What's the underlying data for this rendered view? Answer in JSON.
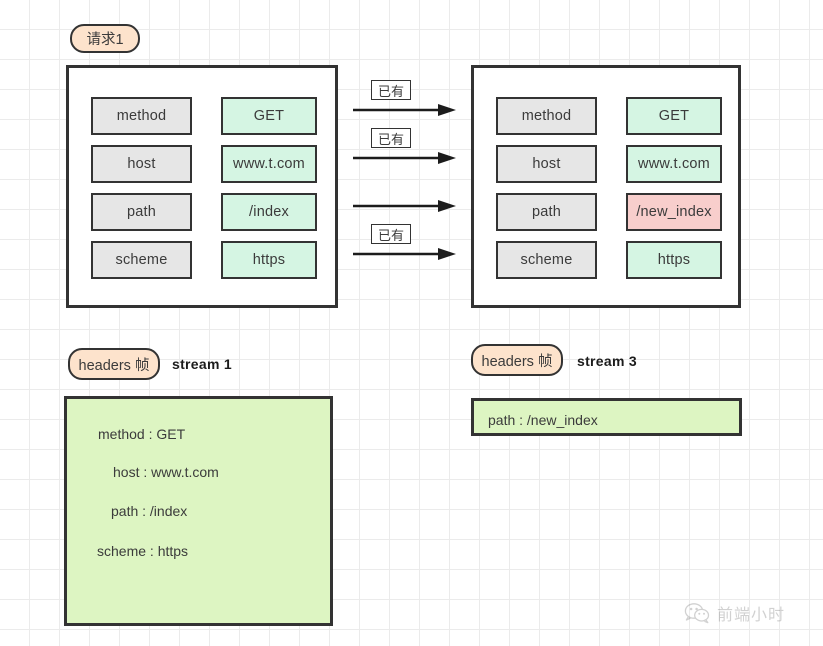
{
  "diagram": {
    "title_badge": "请求1",
    "request_panel_left": {
      "rows": [
        {
          "key": "method",
          "value": "GET"
        },
        {
          "key": "host",
          "value": "www.t.com"
        },
        {
          "key": "path",
          "value": "/index"
        },
        {
          "key": "scheme",
          "value": "https"
        }
      ]
    },
    "request_panel_right": {
      "rows": [
        {
          "key": "method",
          "value": "GET",
          "changed": false
        },
        {
          "key": "host",
          "value": "www.t.com",
          "changed": false
        },
        {
          "key": "path",
          "value": "/new_index",
          "changed": true
        },
        {
          "key": "scheme",
          "value": "https",
          "changed": false
        }
      ]
    },
    "arrows": [
      {
        "label": "已有"
      },
      {
        "label": "已有"
      },
      {
        "label": ""
      },
      {
        "label": "已有"
      }
    ],
    "frames": {
      "left": {
        "badge": "headers 帧",
        "stream": "stream 1",
        "lines": [
          "method : GET",
          "host : www.t.com",
          "path : /index",
          "scheme : https"
        ]
      },
      "right": {
        "badge": "headers 帧",
        "stream": "stream 3",
        "lines": [
          "path : /new_index"
        ]
      }
    },
    "watermark": {
      "icon": "wechat-icon",
      "text": "前端小时"
    },
    "colors": {
      "key_box": "#e6e6e6",
      "value_box": "#d5f5e3",
      "changed_box": "#f8cecc",
      "badge": "#fde3cc",
      "frame_box": "#ddf5c2",
      "stroke": "#333333",
      "grid": "#ebebeb"
    }
  }
}
